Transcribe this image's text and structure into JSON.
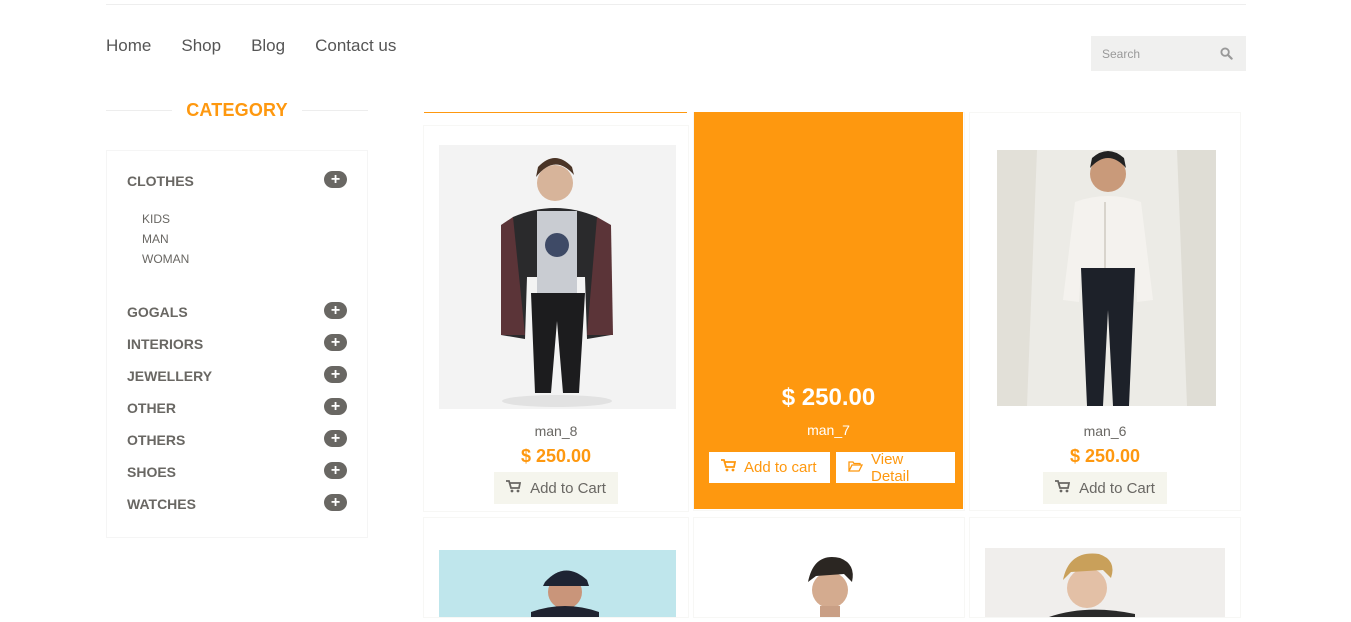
{
  "nav": {
    "items": [
      "Home",
      "Shop",
      "Blog",
      "Contact us"
    ]
  },
  "search": {
    "placeholder": "Search",
    "icon": "search-icon"
  },
  "sidebar": {
    "heading": "CATEGORY",
    "categories": [
      "CLOTHES",
      "GOGALS",
      "INTERIORS",
      "JEWELLERY",
      "OTHER",
      "OTHERS",
      "SHOES",
      "WATCHES"
    ],
    "expand_symbol": "+",
    "clothes_sub": [
      "KIDS",
      "MAN",
      "WOMAN"
    ]
  },
  "colors": {
    "accent": "#fe980f",
    "text": "#696763"
  },
  "products": [
    {
      "name": "man_8",
      "price": "$ 250.00",
      "button": "Add to Cart"
    },
    {
      "name": "man_7",
      "price": "$ 250.00",
      "add_to_cart": "Add to cart",
      "view_detail": "View Detail"
    },
    {
      "name": "man_6",
      "price": "$ 250.00",
      "button": "Add to Cart"
    }
  ]
}
